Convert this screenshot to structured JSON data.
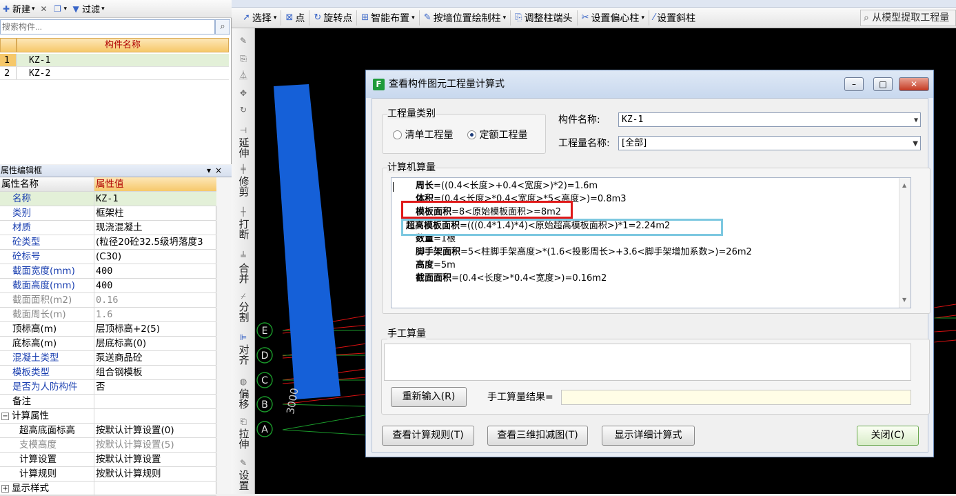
{
  "left_toolbar": {
    "new_label": "新建",
    "filter_label": "过滤"
  },
  "component_search": {
    "placeholder": "搜索构件..."
  },
  "component_list": {
    "header": "构件名称",
    "rows": [
      {
        "num": "1",
        "name": "KZ-1"
      },
      {
        "num": "2",
        "name": "KZ-2"
      }
    ]
  },
  "prop_panel": {
    "title": "属性编辑框",
    "pin": "▾",
    "close": "×",
    "col_name": "属性名称",
    "col_value": "属性值",
    "rows": [
      {
        "name": "名称",
        "value": "KZ-1"
      },
      {
        "name": "类别",
        "value": "框架柱"
      },
      {
        "name": "材质",
        "value": "现浇混凝土"
      },
      {
        "name": "砼类型",
        "value": "(粒径20砼32.5级坍落度3"
      },
      {
        "name": "砼标号",
        "value": "(C30)"
      },
      {
        "name": "截面宽度(mm)",
        "value": "400"
      },
      {
        "name": "截面高度(mm)",
        "value": "400"
      },
      {
        "name": "截面面积(m2)",
        "value": "0.16"
      },
      {
        "name": "截面周长(m)",
        "value": "1.6"
      },
      {
        "name": "顶标高(m)",
        "value": "层顶标高+2(5)"
      },
      {
        "name": "底标高(m)",
        "value": "层底标高(0)"
      },
      {
        "name": "混凝土类型",
        "value": "泵送商品砼"
      },
      {
        "name": "模板类型",
        "value": "组合钢模板"
      },
      {
        "name": "是否为人防构件",
        "value": "否"
      },
      {
        "name": "备注",
        "value": ""
      },
      {
        "name": "计算属性",
        "value": ""
      },
      {
        "name": "超高底面标高",
        "value": "按默认计算设置(0)"
      },
      {
        "name": "支模高度",
        "value": "按默认计算设置(5)"
      },
      {
        "name": "计算设置",
        "value": "按默认计算设置"
      },
      {
        "name": "计算规则",
        "value": "按默认计算规则"
      },
      {
        "name": "显示样式",
        "value": ""
      }
    ]
  },
  "main_toolbar": {
    "select": "选择",
    "point": "点",
    "rotate_point": "旋转点",
    "smart_layout": "智能布置",
    "draw_by_wall": "按墙位置绘制柱",
    "adjust_column_end": "调整柱端头",
    "set_eccentric": "设置偏心柱",
    "set_inclined": "设置斜柱",
    "extract_from_model": "从模型提取工程量"
  },
  "vertical_tools": {
    "extend": "延伸",
    "trim": "修剪",
    "break": "打断",
    "merge": "合并",
    "split": "分割",
    "align": "对齐",
    "offset": "偏移",
    "stretch": "拉伸",
    "setup": "设置"
  },
  "canvas": {
    "axis_labels": [
      "E",
      "D",
      "C",
      "B",
      "A"
    ],
    "dimension": "3000"
  },
  "dialog": {
    "title": "查看构件图元工程量计算式",
    "minimize": "–",
    "maximize": "□",
    "close_x": "✕",
    "qty_type_group": "工程量类别",
    "radio_list_qty": "清单工程量",
    "radio_quota_qty": "定额工程量",
    "component_name_label": "构件名称:",
    "component_name_value": "KZ-1",
    "qty_name_label": "工程量名称:",
    "qty_name_value": "[全部]",
    "computer_calc_group": "计算机算量",
    "formulas": [
      {
        "label": "周长",
        "expr": "=((0.4<长度>+0.4<宽度>)*2)=1.6m"
      },
      {
        "label": "体积",
        "expr": "=(0.4<长度>*0.4<宽度>*5<高度>)=0.8m3"
      },
      {
        "label": "模板面积",
        "expr": "=8<原始模板面积>=8m2"
      },
      {
        "label": "超高模板面积",
        "expr": "=(((0.4*1.4)*4)<原始超高模板面积>)*1=2.24m2"
      },
      {
        "label": "数量",
        "expr": "=1根"
      },
      {
        "label": "脚手架面积",
        "expr": "=5<柱脚手架高度>*(1.6<投影周长>+3.6<脚手架增加系数>)=26m2"
      },
      {
        "label": "高度",
        "expr": "=5m"
      },
      {
        "label": "截面面积",
        "expr": "=(0.4<长度>*0.4<宽度>)=0.16m2"
      }
    ],
    "manual_group": "手工算量",
    "reenter_btn": "重新输入(R)",
    "manual_result_label": "手工算量结果=",
    "view_rules_btn": "查看计算规则(T)",
    "view_3d_btn": "查看三维扣减图(T)",
    "show_detail_btn": "显示详细计算式",
    "close_btn": "关闭(C)"
  }
}
